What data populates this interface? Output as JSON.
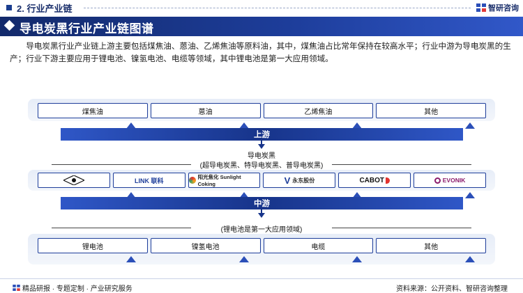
{
  "header": {
    "section": "2. 行业产业链",
    "brand": "智研咨询"
  },
  "title": "导电炭黑行业产业链图谱",
  "intro": "导电炭黑行业产业链上游主要包括煤焦油、蒽油、乙烯焦油等原料油，其中，煤焦油占比常年保持在较高水平；行业中游为导电炭黑的生产；行业下游主要应用于锂电池、镍氢电池、电缆等领域，其中锂电池是第一大应用领域。",
  "upstream": {
    "items": [
      "煤焦油",
      "蒽油",
      "乙烯焦油",
      "其他"
    ],
    "band": "上游"
  },
  "midstream": {
    "product": "导电炭黑",
    "types": "(超导电炭黑、特导电炭黑、普导电炭黑)",
    "companies": [
      "",
      "LINK 联科",
      "阳光焦化 Sunlight Coking",
      "永东股份",
      "CABOT",
      "EVONIK"
    ],
    "band": "中游"
  },
  "downstream": {
    "note": "(锂电池是第一大应用领域)",
    "items": [
      "锂电池",
      "镍氢电池",
      "电缆",
      "其他"
    ]
  },
  "footer": {
    "left": "精品研报 · 专题定制 · 产业研究服务",
    "right": "资料来源：公开资料、智研咨询整理"
  },
  "colors": {
    "primary": "#1d3d9a",
    "dark": "#132a6b"
  }
}
